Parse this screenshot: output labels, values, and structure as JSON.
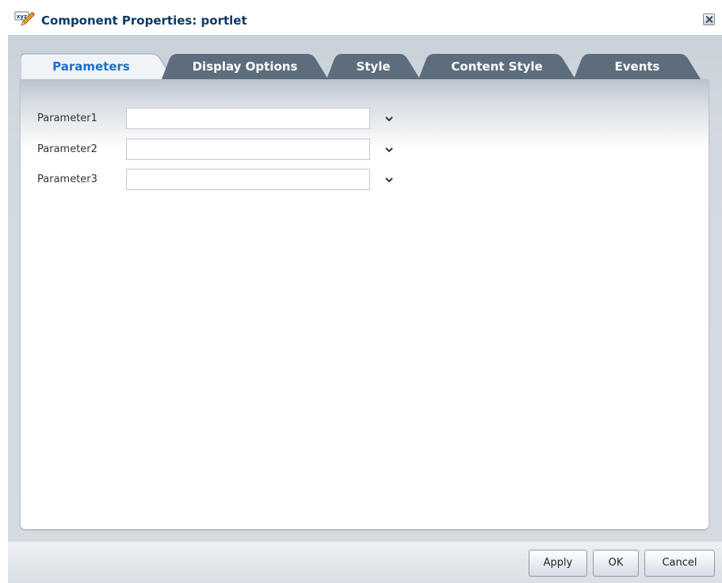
{
  "window": {
    "title": "Component Properties: portlet",
    "title_icon": "property-edit-icon",
    "close_icon": "close-icon"
  },
  "tabs": [
    {
      "label": "Parameters",
      "selected": true
    },
    {
      "label": "Display Options",
      "selected": false
    },
    {
      "label": "Style",
      "selected": false
    },
    {
      "label": "Content Style",
      "selected": false
    },
    {
      "label": "Events",
      "selected": false
    }
  ],
  "parameters": [
    {
      "label": "Parameter1",
      "value": "",
      "dropdown_icon": "chevron-down-icon"
    },
    {
      "label": "Parameter2",
      "value": "",
      "dropdown_icon": "chevron-down-icon"
    },
    {
      "label": "Parameter3",
      "value": "",
      "dropdown_icon": "chevron-down-icon"
    }
  ],
  "buttons": {
    "apply": "Apply",
    "ok": "OK",
    "cancel": "Cancel"
  },
  "colors": {
    "title_text": "#0b3a66",
    "tab_selected_text": "#1d6fc9",
    "tab_unselected_fill": "#5d6d7d",
    "tab_selected_fill": "#f1f4f7"
  }
}
